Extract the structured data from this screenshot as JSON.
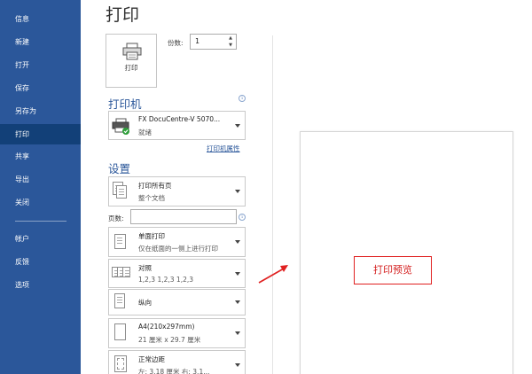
{
  "sidebar": {
    "items": [
      {
        "label": "信息",
        "active": false
      },
      {
        "label": "新建",
        "active": false
      },
      {
        "label": "打开",
        "active": false
      },
      {
        "label": "保存",
        "active": false
      },
      {
        "label": "另存为",
        "active": false
      },
      {
        "label": "打印",
        "active": true
      },
      {
        "label": "共享",
        "active": false
      },
      {
        "label": "导出",
        "active": false
      },
      {
        "label": "关闭",
        "active": false
      },
      {
        "label": "帐户",
        "active": false
      },
      {
        "label": "反馈",
        "active": false
      },
      {
        "label": "选项",
        "active": false
      }
    ]
  },
  "main": {
    "title": "打印",
    "print_button_label": "打印",
    "copies_label": "份数:",
    "copies_value": "1",
    "printer_heading": "打印机",
    "printer": {
      "name": "FX DocuCentre-V 5070...",
      "status": "就绪"
    },
    "printer_properties_link": "打印机属性",
    "settings_heading": "设置",
    "settings": {
      "print_range": {
        "title": "打印所有页",
        "subtitle": "整个文档"
      },
      "pages_label": "页数:",
      "pages_value": "",
      "sides": {
        "title": "单面打印",
        "subtitle": "仅在纸面的一侧上进行打印"
      },
      "collation": {
        "title": "对照",
        "subtitle": "1,2,3    1,2,3    1,2,3"
      },
      "orientation": {
        "title": "纵向"
      },
      "paper_size": {
        "title": "A4(210x297mm)",
        "subtitle": "21 厘米 x 29.7 厘米"
      },
      "margins": {
        "title": "正常边距",
        "subtitle": "左: 3.18 厘米    右: 3.1..."
      }
    },
    "info_icon_glyph": "i"
  },
  "preview": {
    "annotation_label": "打印预览",
    "annotation_color": "#e02020"
  },
  "colors": {
    "sidebar_bg": "#2b579a",
    "sidebar_active": "#124078",
    "accent": "#2b579a"
  },
  "icons": [
    "printer-icon",
    "info-icon",
    "document-stack-icon",
    "pages-icon",
    "single-sided-icon",
    "collated-icon",
    "portrait-icon",
    "paper-icon",
    "margins-icon",
    "red-arrow-icon"
  ]
}
